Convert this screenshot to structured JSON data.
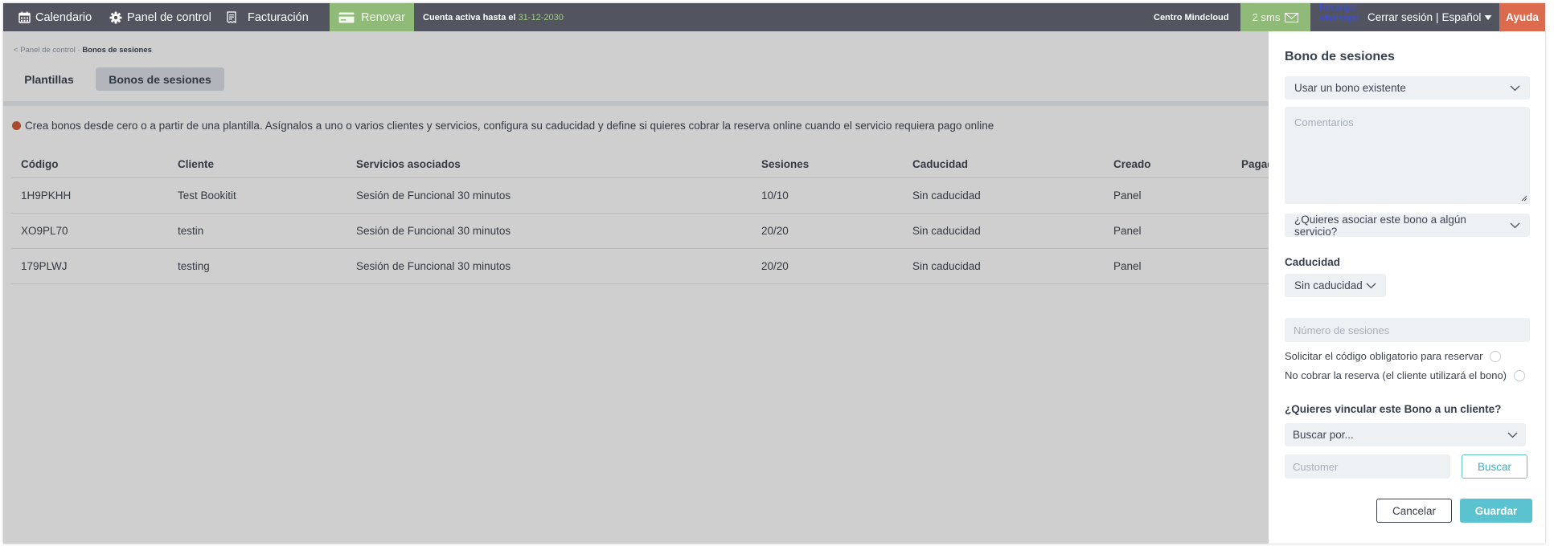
{
  "topbar": {
    "calendar_label": "Calendario",
    "control_panel_label": "Panel de control",
    "billing_label": "Facturación",
    "renew_label": "Renovar",
    "account_text": "Cuenta activa hasta el",
    "account_date": "31-12-2030",
    "center_name": "Centro Mindcloud",
    "sms_label": "2 sms",
    "whatsapp_line1": "Recargar",
    "whatsapp_line2": "whatsapp",
    "logout_label": "Cerrar sesión",
    "separator": "|",
    "language_label": "Español",
    "help_label": "Ayuda"
  },
  "breadcrumb": {
    "parent": "< Panel de control",
    "separator": "·",
    "current": "Bonos de sesiones"
  },
  "tabs": [
    {
      "label": "Plantillas"
    },
    {
      "label": "Bonos de sesiones"
    }
  ],
  "info_text": "Crea bonos desde cero o a partir de una plantilla. Asígnalos a uno o varios clientes y servicios, configura su caducidad y define si quieres cobrar la reserva online cuando el servicio requiera pago online",
  "table": {
    "headers": [
      "Código",
      "Cliente",
      "Servicios asociados",
      "Sesiones",
      "Caducidad",
      "Creado",
      "Pagado"
    ],
    "rows": [
      [
        "1H9PKHH",
        "Test Bookitit",
        "Sesión de Funcional 30 minutos",
        "10/10",
        "Sin caducidad",
        "Panel"
      ],
      [
        "XO9PL70",
        "testin",
        "Sesión de Funcional 30 minutos",
        "20/20",
        "Sin caducidad",
        "Panel"
      ],
      [
        "179PLWJ",
        "testing",
        "Sesión de Funcional 30 minutos",
        "20/20",
        "Sin caducidad",
        "Panel"
      ]
    ]
  },
  "panel": {
    "title": "Bono de sesiones",
    "bono_select": "Usar un bono existente",
    "comments_placeholder": "Comentarios",
    "service_select": "¿Quieres asociar este bono a algún servicio?",
    "expiry_label": "Caducidad",
    "expiry_select": "Sin caducidad",
    "sessions_placeholder": "Número de sesiones",
    "require_code_label": "Solicitar el código obligatorio para reservar",
    "no_charge_label": "No cobrar la reserva (el cliente utilizará el bono)",
    "link_client_label": "¿Quieres vincular este Bono a un cliente?",
    "search_by_select": "Buscar por...",
    "customer_placeholder": "Customer",
    "search_button": "Buscar",
    "cancel_button": "Cancelar",
    "save_button": "Guardar"
  },
  "colors": {
    "topbar": "#525560",
    "green": "#8fba77",
    "help": "#dc6b4e",
    "accent": "#5bc2cf",
    "info_dot": "#d25a35"
  }
}
